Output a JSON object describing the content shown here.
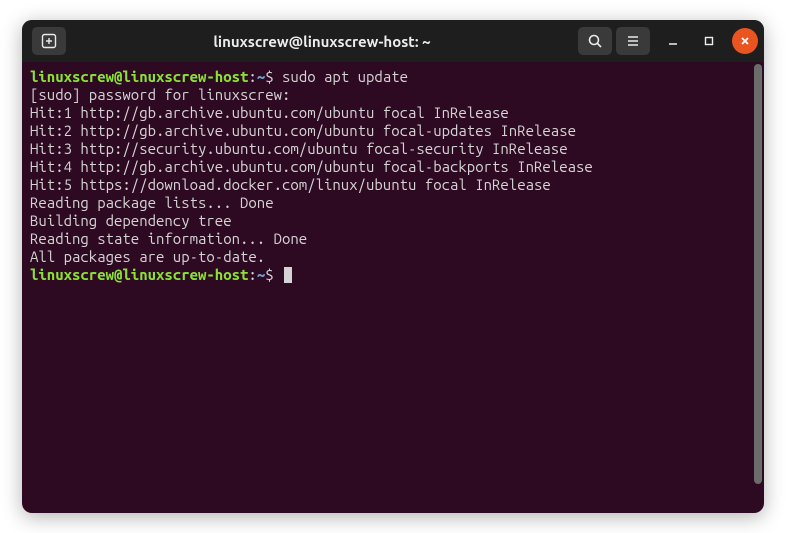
{
  "titlebar": {
    "title": "linuxscrew@linuxscrew-host: ~"
  },
  "terminal": {
    "prompt": {
      "user_host": "linuxscrew@linuxscrew-host",
      "separator": ":",
      "path": "~",
      "symbol": "$"
    },
    "command": "sudo apt update",
    "lines": [
      "[sudo] password for linuxscrew:",
      "Hit:1 http://gb.archive.ubuntu.com/ubuntu focal InRelease",
      "Hit:2 http://gb.archive.ubuntu.com/ubuntu focal-updates InRelease",
      "Hit:3 http://security.ubuntu.com/ubuntu focal-security InRelease",
      "Hit:4 http://gb.archive.ubuntu.com/ubuntu focal-backports InRelease",
      "Hit:5 https://download.docker.com/linux/ubuntu focal InRelease",
      "Reading package lists... Done",
      "Building dependency tree",
      "Reading state information... Done",
      "All packages are up-to-date."
    ]
  }
}
